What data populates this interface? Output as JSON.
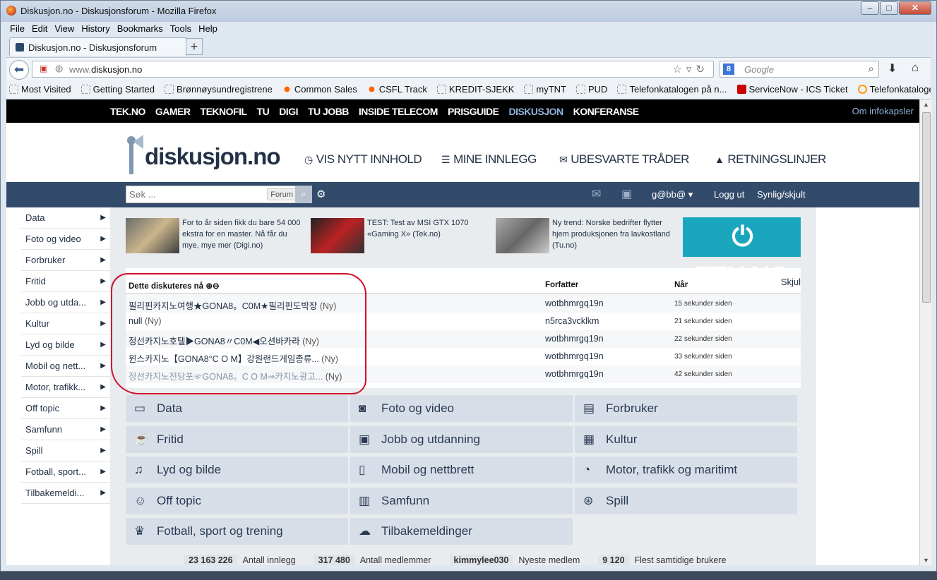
{
  "window": {
    "title": "Diskusjon.no - Diskusjonsforum - Mozilla Firefox",
    "min": "–",
    "max": "□",
    "close": "✕"
  },
  "menu": [
    "File",
    "Edit",
    "View",
    "History",
    "Bookmarks",
    "Tools",
    "Help"
  ],
  "tab": {
    "label": "Diskusjon.no - Diskusjonsforum",
    "new": "+"
  },
  "url": {
    "prefix": "www.",
    "domain": "diskusjon.no"
  },
  "search": {
    "placeholder": "Google"
  },
  "bookmarks": [
    "Most Visited",
    "Getting Started",
    "Brønnøysundregistrene",
    "Common Sales",
    "CSFL Track",
    "KREDIT-SJEKK",
    "myTNT",
    "PUD",
    "Telefonkatalogen på n...",
    "ServiceNow - ICS Ticket",
    "Telefonkatalogen™ Be..."
  ],
  "topnav": {
    "links": [
      "TEK.NO",
      "GAMER",
      "TEKNOFIL",
      "TU",
      "DIGI",
      "TU JOBB",
      "INSIDE TELECOM",
      "PRISGUIDE",
      "DISKUSJON",
      "KONFERANSE"
    ],
    "active": "DISKUSJON",
    "info": "Om infokapsler"
  },
  "header": {
    "logo": "diskusjon.no",
    "links": [
      "VIS NYTT INNHOLD",
      "MINE INNLEGG",
      "UBESVARTE TRÅDER",
      "RETNINGSLINJER"
    ]
  },
  "forumsearch": {
    "placeholder": "Søk ...",
    "scope": "Forum"
  },
  "userbar": {
    "user": "g@bb@",
    "logout": "Logg ut",
    "toggle": "Synlig/skjult"
  },
  "sidebar": [
    "Data",
    "Foto og video",
    "Forbruker",
    "Fritid",
    "Jobb og utda...",
    "Kultur",
    "Lyd og bilde",
    "Mobil og nett...",
    "Motor, trafikk...",
    "Off topic",
    "Samfunn",
    "Spill",
    "Fotball, sport...",
    "Tilbakemeldi..."
  ],
  "news": [
    {
      "text": "For to år siden fikk du bare 54 000 ekstra for en master. Nå får du mye, mye mer (Digi.no)"
    },
    {
      "text": "TEST: Test av MSI GTX 1070 «Gaming X» (Tek.no)"
    },
    {
      "text": "Ny trend: Norske bedrifter flytter hjem produksjonen fra lavkostland (Tu.no)"
    }
  ],
  "banner": "TEK.NO",
  "discussion": {
    "header": "Dette diskuteres nå",
    "author_col": "Forfatter",
    "when_col": "Når",
    "hide": "Skjul",
    "rows": [
      {
        "title": "필리핀카지노여행★GONA8。C0M★필리핀도박장",
        "ny": "(Ny)",
        "author": "wotbhmrgq19n",
        "when": "15 sekunder siden"
      },
      {
        "title": "null",
        "ny": "(Ny)",
        "author": "n5rca3vcklkm",
        "when": "21 sekunder siden"
      },
      {
        "title": "정선카지노호텔▶GONA8〃C0M◀오션바카라",
        "ny": "(Ny)",
        "author": "wotbhmrgq19n",
        "when": "22 sekunder siden"
      },
      {
        "title": "윈스카지노【GONA8°C O M】강원랜드게임종류...",
        "ny": "(Ny)",
        "author": "wotbhmrgq19n",
        "when": "33 sekunder siden"
      },
      {
        "title": "정선카지노전당포☞GONA8。C O M⇒카지노광고...",
        "ny": "(Ny)",
        "author": "wotbhmrgq19n",
        "when": "42 sekunder siden"
      }
    ]
  },
  "categories": [
    {
      "label": "Data",
      "icon": "monitor-icon"
    },
    {
      "label": "Foto og video",
      "icon": "camera-icon"
    },
    {
      "label": "Forbruker",
      "icon": "card-icon"
    },
    {
      "label": "Fritid",
      "icon": "cup-icon"
    },
    {
      "label": "Jobb og utdanning",
      "icon": "briefcase-icon"
    },
    {
      "label": "Kultur",
      "icon": "film-icon"
    },
    {
      "label": "Lyd og bilde",
      "icon": "music-icon"
    },
    {
      "label": "Mobil og nettbrett",
      "icon": "phone-icon"
    },
    {
      "label": "Motor, trafikk og maritimt",
      "icon": "gauge-icon"
    },
    {
      "label": "Off topic",
      "icon": "smiley-icon"
    },
    {
      "label": "Samfunn",
      "icon": "building-icon"
    },
    {
      "label": "Spill",
      "icon": "gamepad-icon"
    },
    {
      "label": "Fotball, sport og trening",
      "icon": "trophy-icon"
    },
    {
      "label": "Tilbakemeldinger",
      "icon": "chat-icon"
    }
  ],
  "stats": [
    {
      "value": "23 163 226",
      "label": "Antall innlegg"
    },
    {
      "value": "317 480",
      "label": "Antall medlemmer"
    },
    {
      "value": "kimmylee030",
      "label": "Nyeste medlem"
    },
    {
      "value": "9 120",
      "label": "Flest samtidige brukere"
    }
  ]
}
